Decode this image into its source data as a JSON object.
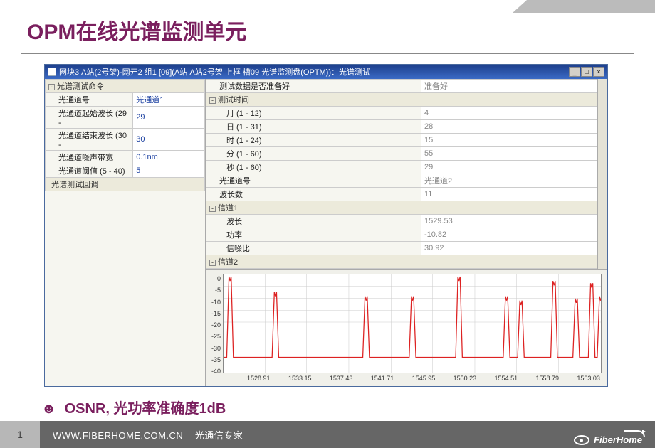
{
  "title": "OPM在线光谱监测单元",
  "window_title": "网块3 A站(2号架)-网元2 组1 [09](A站 A站2号架 上框 槽09 光谱监测盘(OPTM))：光谱测试",
  "win_btns": {
    "min": "_",
    "max": "□",
    "close": "×"
  },
  "left_panel_header": "光谱测试命令",
  "left_rows": [
    {
      "k": "光通道号",
      "v": "光通道1"
    },
    {
      "k": "光通道起始波长 (29 -",
      "v": "29"
    },
    {
      "k": "光通道结束波长 (30 -",
      "v": "30"
    },
    {
      "k": "光通道噪声带宽",
      "v": "0.1nm"
    },
    {
      "k": "光通道阈值 (5 - 40)",
      "v": "5"
    }
  ],
  "left_footer": "光谱测试回调",
  "right_top": {
    "k": "测试数据是否准备好",
    "v": "准备好"
  },
  "right_time_hdr": "测试时间",
  "right_time": [
    {
      "k": "月 (1 - 12)",
      "v": "4"
    },
    {
      "k": "日 (1 - 31)",
      "v": "28"
    },
    {
      "k": "时 (1 - 24)",
      "v": "15"
    },
    {
      "k": "分 (1 - 60)",
      "v": "55"
    },
    {
      "k": "秒 (1 - 60)",
      "v": "29"
    }
  ],
  "right_mid": [
    {
      "k": "光通道号",
      "v": "光通道2"
    },
    {
      "k": "波长数",
      "v": "11"
    }
  ],
  "right_ch1_hdr": "信道1",
  "right_ch1": [
    {
      "k": "波长",
      "v": "1529.53"
    },
    {
      "k": "功率",
      "v": "-10.82"
    },
    {
      "k": "信噪比",
      "v": "30.92"
    }
  ],
  "right_ch2_hdr": "信道2",
  "chart_data": {
    "type": "line",
    "ylabel": "",
    "xlabel": "",
    "ylim": [
      -45,
      0
    ],
    "yticks": [
      0,
      -5,
      -10,
      -15,
      -20,
      -25,
      -30,
      -35,
      -40
    ],
    "xticks": [
      "1528.91",
      "1533.15",
      "1537.43",
      "1541.71",
      "1545.95",
      "1550.23",
      "1554.51",
      "1558.79",
      "1563.03"
    ],
    "baseline": -38,
    "peaks_x": [
      1529.5,
      1533.6,
      1541.8,
      1546.0,
      1550.2,
      1554.5,
      1555.8,
      1558.8,
      1560.8,
      1562.2,
      1563.0
    ],
    "peaks_y": [
      -3,
      -10,
      -12,
      -12,
      -3,
      -12,
      -14,
      -5,
      -13,
      -6,
      -12
    ]
  },
  "bullet": {
    "dot": "☻",
    "osnr": "OSNR, ",
    "rest": "光功率准确度1dB"
  },
  "footer": {
    "page": "1",
    "site": "WWW.FIBERHOME.COM.CN",
    "slogan": "光通信专家",
    "brand": "FiberHome"
  }
}
